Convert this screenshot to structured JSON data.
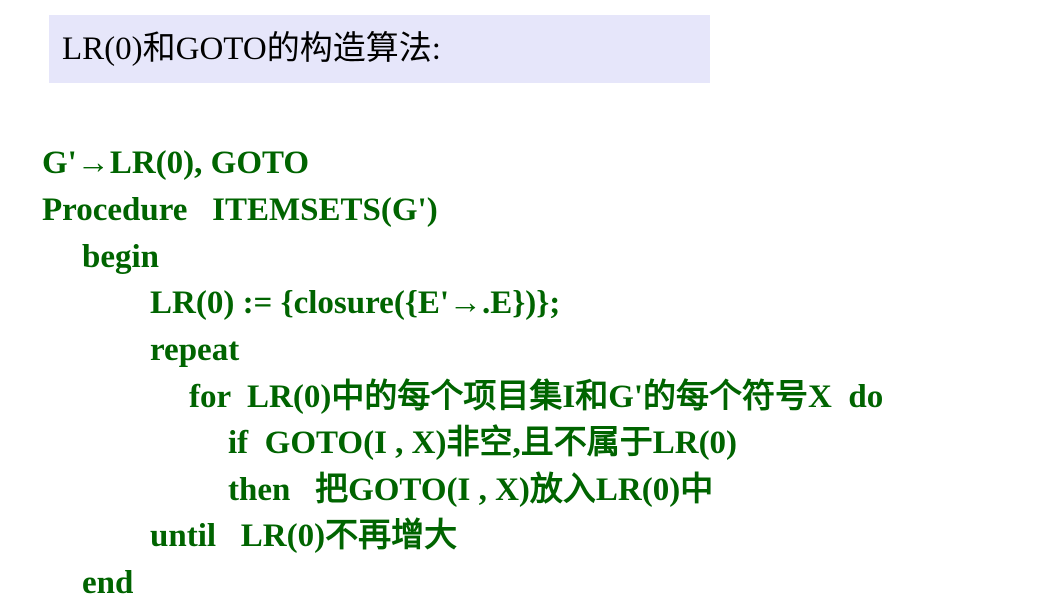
{
  "title": "LR(0)和GOTO的构造算法:",
  "lines": [
    "G'→LR(0), GOTO",
    "Procedure   ITEMSETS(G')",
    "begin",
    "LR(0) := {closure({E'→.E})};",
    "repeat",
    "for  LR(0)中的每个项目集I和G'的每个符号X  do",
    "if  GOTO(I , X)非空,且不属于LR(0)",
    "then   把GOTO(I , X)放入LR(0)中",
    "until   LR(0)不再增大",
    "end"
  ],
  "colors": {
    "code_text": "#006400",
    "title_background": "#e6e6fa",
    "title_text": "#000000"
  }
}
